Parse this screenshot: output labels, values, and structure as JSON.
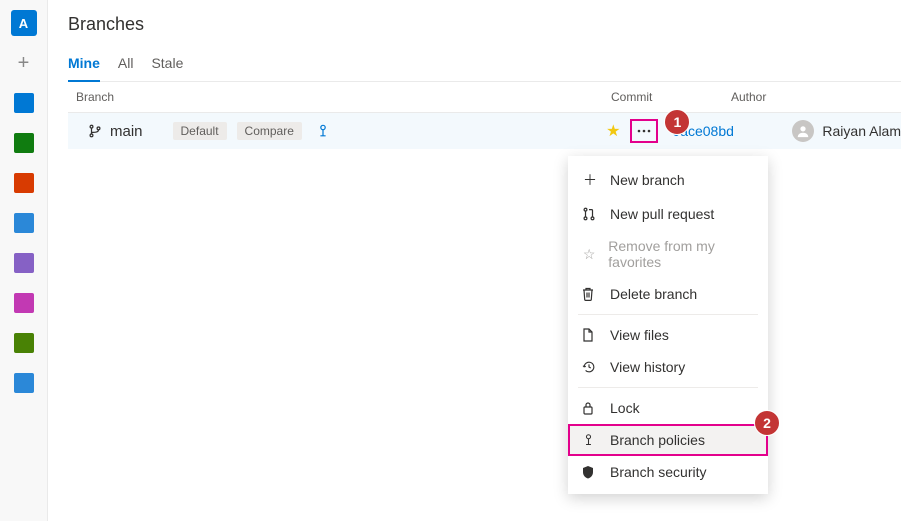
{
  "rail": {
    "avatar_letter": "A",
    "tiles": [
      {
        "name": "boards-icon",
        "bg": "#0078d4"
      },
      {
        "name": "repos-icon",
        "bg": "#107c10"
      },
      {
        "name": "pipelines-icon",
        "bg": "#d83b01"
      },
      {
        "name": "rocket-icon",
        "bg": "#2b88d8"
      },
      {
        "name": "testplans-icon",
        "bg": "#8661c5"
      },
      {
        "name": "artifacts-icon",
        "bg": "#c239b3"
      },
      {
        "name": "shield-icon",
        "bg": "#498205"
      },
      {
        "name": "hourglass-icon",
        "bg": "#2b88d8"
      }
    ]
  },
  "page": {
    "title": "Branches"
  },
  "tabs": [
    {
      "label": "Mine",
      "active": true
    },
    {
      "label": "All",
      "active": false
    },
    {
      "label": "Stale",
      "active": false
    }
  ],
  "columns": {
    "branch": "Branch",
    "commit": "Commit",
    "author": "Author"
  },
  "branch": {
    "name": "main",
    "badges": [
      "Default",
      "Compare"
    ],
    "commit": "0ace08bd",
    "author": "Raiyan Alam"
  },
  "callouts": {
    "one": "1",
    "two": "2"
  },
  "menu": {
    "new_branch": "New branch",
    "new_pr": "New pull request",
    "remove_fav": "Remove from my favorites",
    "delete": "Delete branch",
    "view_files": "View files",
    "view_history": "View history",
    "lock": "Lock",
    "policies": "Branch policies",
    "security": "Branch security"
  }
}
